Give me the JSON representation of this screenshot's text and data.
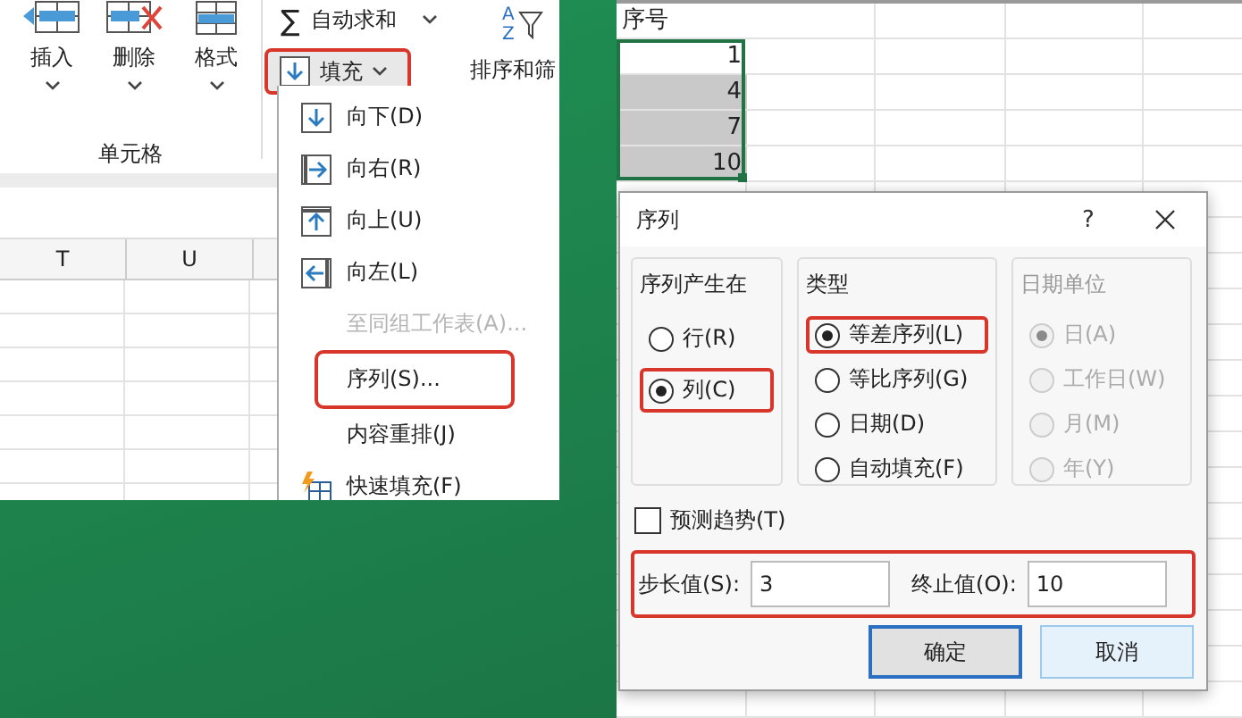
{
  "ribbon": {
    "cells_group": {
      "buttons": [
        {
          "label": "插入",
          "kind": "insert"
        },
        {
          "label": "删除",
          "kind": "delete"
        },
        {
          "label": "格式",
          "kind": "format"
        }
      ],
      "label": "单元格"
    },
    "autosum": {
      "symbol": "∑",
      "label": "自动求和"
    },
    "fill_button": {
      "label": "填充",
      "highlighted": true
    },
    "sort_filter": {
      "letters": [
        "A",
        "Z"
      ],
      "label": "排序和筛"
    }
  },
  "left_sheet": {
    "columns": [
      "T",
      "U"
    ]
  },
  "fill_menu": [
    {
      "label": "向下(D)",
      "kind": "down",
      "disabled": false,
      "highlighted": false
    },
    {
      "label": "向右(R)",
      "kind": "right",
      "disabled": false,
      "highlighted": false
    },
    {
      "label": "向上(U)",
      "kind": "up",
      "disabled": false,
      "highlighted": false
    },
    {
      "label": "向左(L)",
      "kind": "left",
      "disabled": false,
      "highlighted": false
    },
    {
      "label": "至同组工作表(A)...",
      "disabled": true,
      "highlighted": false
    },
    {
      "label": "序列(S)...",
      "disabled": false,
      "highlighted": true
    },
    {
      "label": "内容重排(J)",
      "disabled": false,
      "highlighted": false
    },
    {
      "label": "快速填充(F)",
      "kind": "flash",
      "disabled": false,
      "highlighted": false
    }
  ],
  "right_sheet": {
    "cells": [
      {
        "text": "序号",
        "kind": "header",
        "selected": false
      },
      {
        "text": "1",
        "kind": "number",
        "selected": false
      },
      {
        "text": "4",
        "kind": "number",
        "selected": true
      },
      {
        "text": "7",
        "kind": "number",
        "selected": true
      },
      {
        "text": "10",
        "kind": "number",
        "selected": true
      }
    ]
  },
  "dialog": {
    "title": "序列",
    "help": "?",
    "groups": [
      {
        "legend": "序列产生在",
        "disabled": false,
        "options": [
          {
            "label": "行(R)",
            "selected": false,
            "highlighted": false
          },
          {
            "label": "列(C)",
            "selected": true,
            "highlighted": true
          }
        ]
      },
      {
        "legend": "类型",
        "disabled": false,
        "options": [
          {
            "label": "等差序列(L)",
            "selected": true,
            "highlighted": true
          },
          {
            "label": "等比序列(G)",
            "selected": false,
            "highlighted": false
          },
          {
            "label": "日期(D)",
            "selected": false,
            "highlighted": false
          },
          {
            "label": "自动填充(F)",
            "selected": false,
            "highlighted": false
          }
        ]
      },
      {
        "legend": "日期单位",
        "disabled": true,
        "options": [
          {
            "label": "日(A)",
            "selected": true,
            "highlighted": false
          },
          {
            "label": "工作日(W)",
            "selected": false,
            "highlighted": false
          },
          {
            "label": "月(M)",
            "selected": false,
            "highlighted": false
          },
          {
            "label": "年(Y)",
            "selected": false,
            "highlighted": false
          }
        ]
      }
    ],
    "checkbox": {
      "label": "预测趋势(T)",
      "checked": false
    },
    "fields": {
      "highlighted": true,
      "items": [
        {
          "label": "步长值(S):",
          "value": "3"
        },
        {
          "label": "终止值(O):",
          "value": "10"
        }
      ]
    },
    "buttons": [
      {
        "label": "确定",
        "default": true
      },
      {
        "label": "取消",
        "default": false
      }
    ]
  }
}
